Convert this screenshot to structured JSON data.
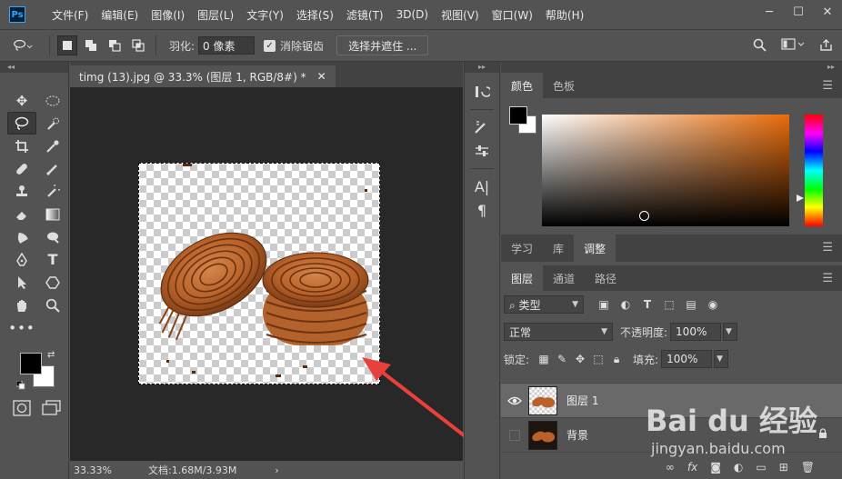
{
  "app": {
    "logo": "Ps",
    "menu": [
      "文件(F)",
      "编辑(E)",
      "图像(I)",
      "图层(L)",
      "文字(Y)",
      "选择(S)",
      "滤镜(T)",
      "3D(D)",
      "视图(V)",
      "窗口(W)",
      "帮助(H)"
    ],
    "window_controls": [
      "minimize-icon",
      "maximize-icon",
      "close-icon"
    ]
  },
  "options_bar": {
    "feather_label": "羽化:",
    "feather_value": "0 像素",
    "antialias_label": "消除锯齿",
    "antialias_checked": true,
    "select_mask_button": "选择并遮住 ..."
  },
  "document": {
    "tab_title": "timg (13).jpg @ 33.3% (图层 1, RGB/8#) *",
    "zoom": "33.33%",
    "doc_info": "文档:1.68M/3.93M"
  },
  "color_panel": {
    "tabs": [
      "颜色",
      "色板"
    ],
    "foreground": "#000000",
    "background": "#ffffff",
    "hue": "#e86c0b"
  },
  "adjust_tabs": [
    "学习",
    "库",
    "调整"
  ],
  "layers_panel": {
    "tabs": [
      "图层",
      "通道",
      "路径"
    ],
    "filter_kind": "类型",
    "blend_mode": "正常",
    "opacity_label": "不透明度:",
    "opacity_value": "100%",
    "lock_label": "锁定:",
    "fill_label": "填充:",
    "fill_value": "100%",
    "layers": [
      {
        "name": "图层 1",
        "visible": true,
        "selected": true,
        "locked": false
      },
      {
        "name": "背景",
        "visible": false,
        "selected": false,
        "locked": true
      }
    ]
  },
  "watermark": {
    "main": "Bai du 经验",
    "sub": "jingyan.baidu.com"
  },
  "colors": {
    "accent_arrow": "#e8403c",
    "panel_bg": "#535353",
    "canvas_bg": "#282828"
  }
}
